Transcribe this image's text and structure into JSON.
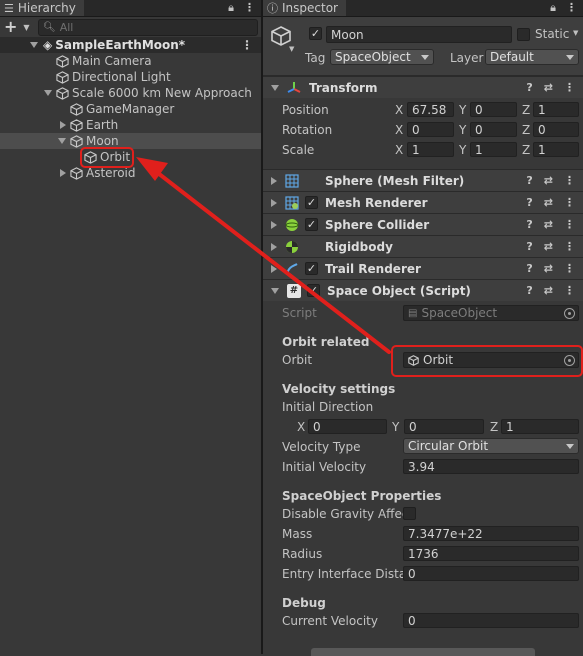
{
  "hierarchy": {
    "tab_title": "Hierarchy",
    "add_label": "+",
    "search_placeholder": "All",
    "scene_name": "SampleEarthMoon*",
    "items": [
      {
        "label": "Main Camera"
      },
      {
        "label": "Directional Light"
      },
      {
        "label": "Scale 6000 km New Approach"
      },
      {
        "label": "GameManager"
      },
      {
        "label": "Earth"
      },
      {
        "label": "Moon"
      },
      {
        "label": "Orbit"
      },
      {
        "label": "Asteroid"
      }
    ]
  },
  "inspector": {
    "tab_title": "Inspector",
    "object_name": "Moon",
    "static_label": "Static",
    "tag_label": "Tag",
    "tag_value": "SpaceObject",
    "layer_label": "Layer",
    "layer_value": "Default",
    "transform": {
      "title": "Transform",
      "position_label": "Position",
      "rotation_label": "Rotation",
      "scale_label": "Scale",
      "axis_x": "X",
      "axis_y": "Y",
      "axis_z": "Z",
      "position": {
        "x": "67.58",
        "y": "0",
        "z": "1"
      },
      "rotation": {
        "x": "0",
        "y": "0",
        "z": "0"
      },
      "scale": {
        "x": "1",
        "y": "1",
        "z": "1"
      }
    },
    "components": [
      {
        "title": "Sphere (Mesh Filter)"
      },
      {
        "title": "Mesh Renderer"
      },
      {
        "title": "Sphere Collider"
      },
      {
        "title": "Rigidbody"
      },
      {
        "title": "Trail Renderer"
      },
      {
        "title": "Space Object (Script)"
      }
    ],
    "script": {
      "script_label": "Script",
      "script_value": "SpaceObject",
      "orbit_section": "Orbit related",
      "orbit_label": "Orbit",
      "orbit_value": "Orbit",
      "velocity_section": "Velocity settings",
      "initial_direction_label": "Initial Direction",
      "dir": {
        "x": "0",
        "y": "0",
        "z": "1"
      },
      "velocity_type_label": "Velocity Type",
      "velocity_type_value": "Circular Orbit",
      "initial_velocity_label": "Initial Velocity",
      "initial_velocity_value": "3.94",
      "props_section": "SpaceObject Properties",
      "disable_gravity_label": "Disable Gravity Affec",
      "mass_label": "Mass",
      "mass_value": "7.3477e+22",
      "radius_label": "Radius",
      "radius_value": "1736",
      "entry_label": "Entry Interface Distar",
      "entry_value": "0",
      "debug_section": "Debug",
      "current_velocity_label": "Current Velocity",
      "current_velocity_value": "0"
    }
  },
  "colors": {
    "annotation": "#e0201c",
    "panel_bg": "#383838",
    "field_bg": "#2a2a2a"
  }
}
